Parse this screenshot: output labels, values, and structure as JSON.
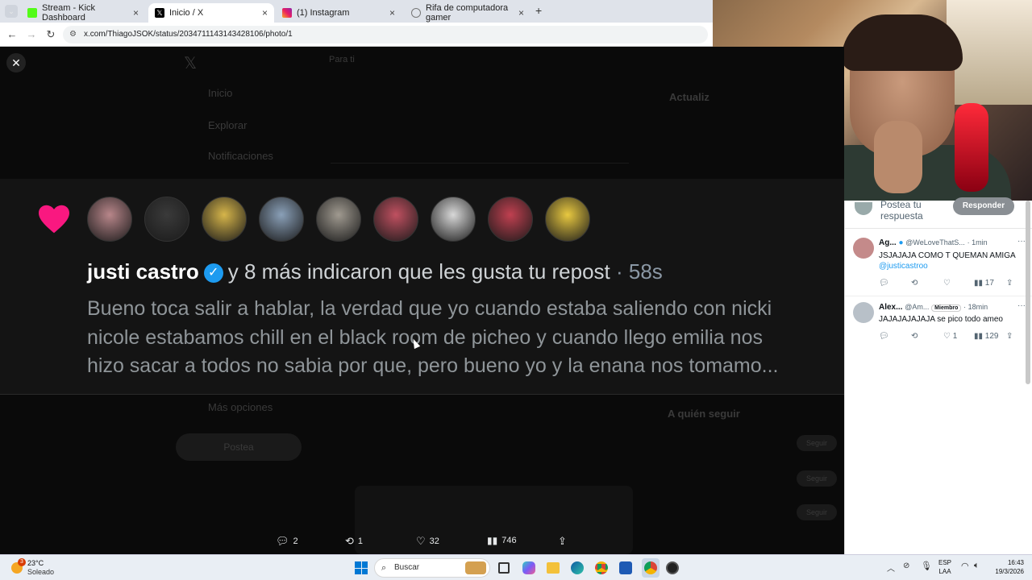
{
  "browser": {
    "tabs": [
      {
        "title": "Stream - Kick Dashboard",
        "icon": "kick-icon",
        "active": false
      },
      {
        "title": "Inicio / X",
        "icon": "x-logo-icon",
        "active": true
      },
      {
        "title": "(1) Instagram",
        "icon": "instagram-icon",
        "active": false
      },
      {
        "title": "Rifa de computadora gamer",
        "icon": "globe-icon",
        "active": false
      }
    ],
    "url": "x.com/ThiagoJSOK/status/2034711143143428106/photo/1"
  },
  "x_page": {
    "nav": [
      "Inicio",
      "Explorar",
      "Notificaciones",
      "Más opciones"
    ],
    "post_button": "Postea",
    "tabs": [
      "Para ti"
    ],
    "sidebar_heading": "A quién seguir",
    "trending_heading": "Actualiz",
    "follow_label": "Seguir"
  },
  "notification": {
    "name": "justi castro",
    "action": "y 8 más indicaron que les gusta tu repost",
    "time": "· 58s",
    "body_lines": [
      "Bueno toca salir a hablar, la verdad que yo cuando estaba saliendo con nicki",
      "nicole estabamos chill en el black room de picheo y cuando llego emilia nos",
      "hizo sacar a todos no sabia por que, pero bueno yo y la enana nos tomamo..."
    ],
    "avatar_colors": [
      "#b8868a",
      "#3a3a3a",
      "#d6b54a",
      "#8aa0b8",
      "#a09a90",
      "#c05060",
      "#d8d8d8",
      "#c04050",
      "#e8c840"
    ]
  },
  "photo_stats": {
    "replies": "2",
    "reposts": "1",
    "likes": "32",
    "views": "746"
  },
  "replies_panel": {
    "reply_placeholder": "Postea tu respuesta",
    "reply_button": "Responder",
    "items": [
      {
        "name": "Ag...",
        "handle": "@WeLoveThatS...",
        "time": "· 1min",
        "text": "JSJAJAJA COMO T QUEMAN AMIGA",
        "mention": "@justicastroo",
        "likes": "",
        "views": "17"
      },
      {
        "name": "Alex...",
        "handle": "@Am...",
        "badge": "Miembro",
        "time": "· 18min",
        "text": "JAJAJAJAJAJA se pico todo ameo",
        "likes": "1",
        "views": "129"
      }
    ]
  },
  "taskbar": {
    "weather_temp": "23°C",
    "weather_desc": "Soleado",
    "weather_badge": "3",
    "search_label": "Buscar",
    "lang_top": "ESP",
    "lang_bottom": "LAA",
    "clock_time": "16:43",
    "clock_date": "19/3/2026"
  }
}
